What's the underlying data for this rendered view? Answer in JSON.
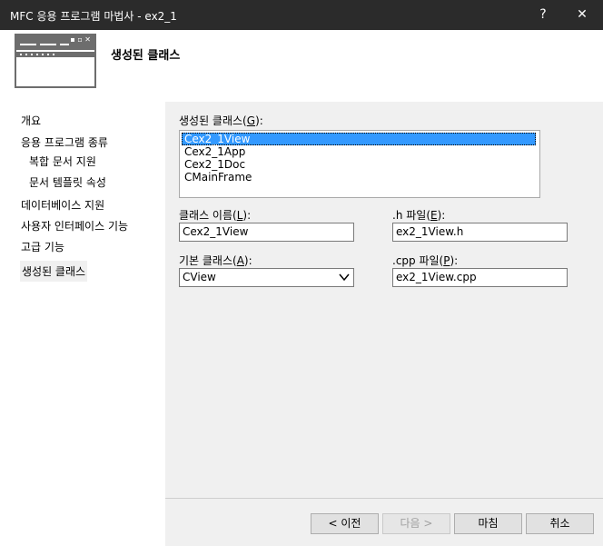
{
  "window": {
    "title": "MFC 응용 프로그램 마법사 - ex2_1",
    "help_glyph": "?",
    "close_glyph": "✕"
  },
  "header": {
    "title": "생성된 클래스",
    "icon_dots": "▪ ▫ ✕"
  },
  "nav": {
    "items": [
      {
        "label": "개요"
      },
      {
        "label": "응용 프로그램 종류"
      },
      {
        "label": "복합 문서 지원"
      },
      {
        "label": "문서 템플릿 속성"
      },
      {
        "label": "데이터베이스 지원"
      },
      {
        "label": "사용자 인터페이스 기능"
      },
      {
        "label": "고급 기능"
      },
      {
        "label": "생성된 클래스"
      }
    ]
  },
  "form": {
    "classes_label": "생성된 클래스(",
    "classes_key": "G",
    "classes_label_end": "):",
    "classes": [
      "Cex2_1View",
      "Cex2_1App",
      "Cex2_1Doc",
      "CMainFrame"
    ],
    "class_name_label": "클래스 이름(",
    "class_name_key": "L",
    "class_name_end": "):",
    "class_name_value": "Cex2_1View",
    "h_file_label": ".h 파일(",
    "h_file_key": "E",
    "h_file_end": "):",
    "h_file_value": "ex2_1View.h",
    "base_class_label": "기본 클래스(",
    "base_class_key": "A",
    "base_class_end": "):",
    "base_class_value": "CView",
    "cpp_file_label": ".cpp 파일(",
    "cpp_file_key": "P",
    "cpp_file_end": "):",
    "cpp_file_value": "ex2_1View.cpp"
  },
  "buttons": {
    "prev": "< 이전",
    "next": "다음 >",
    "finish": "마침",
    "cancel": "취소"
  }
}
